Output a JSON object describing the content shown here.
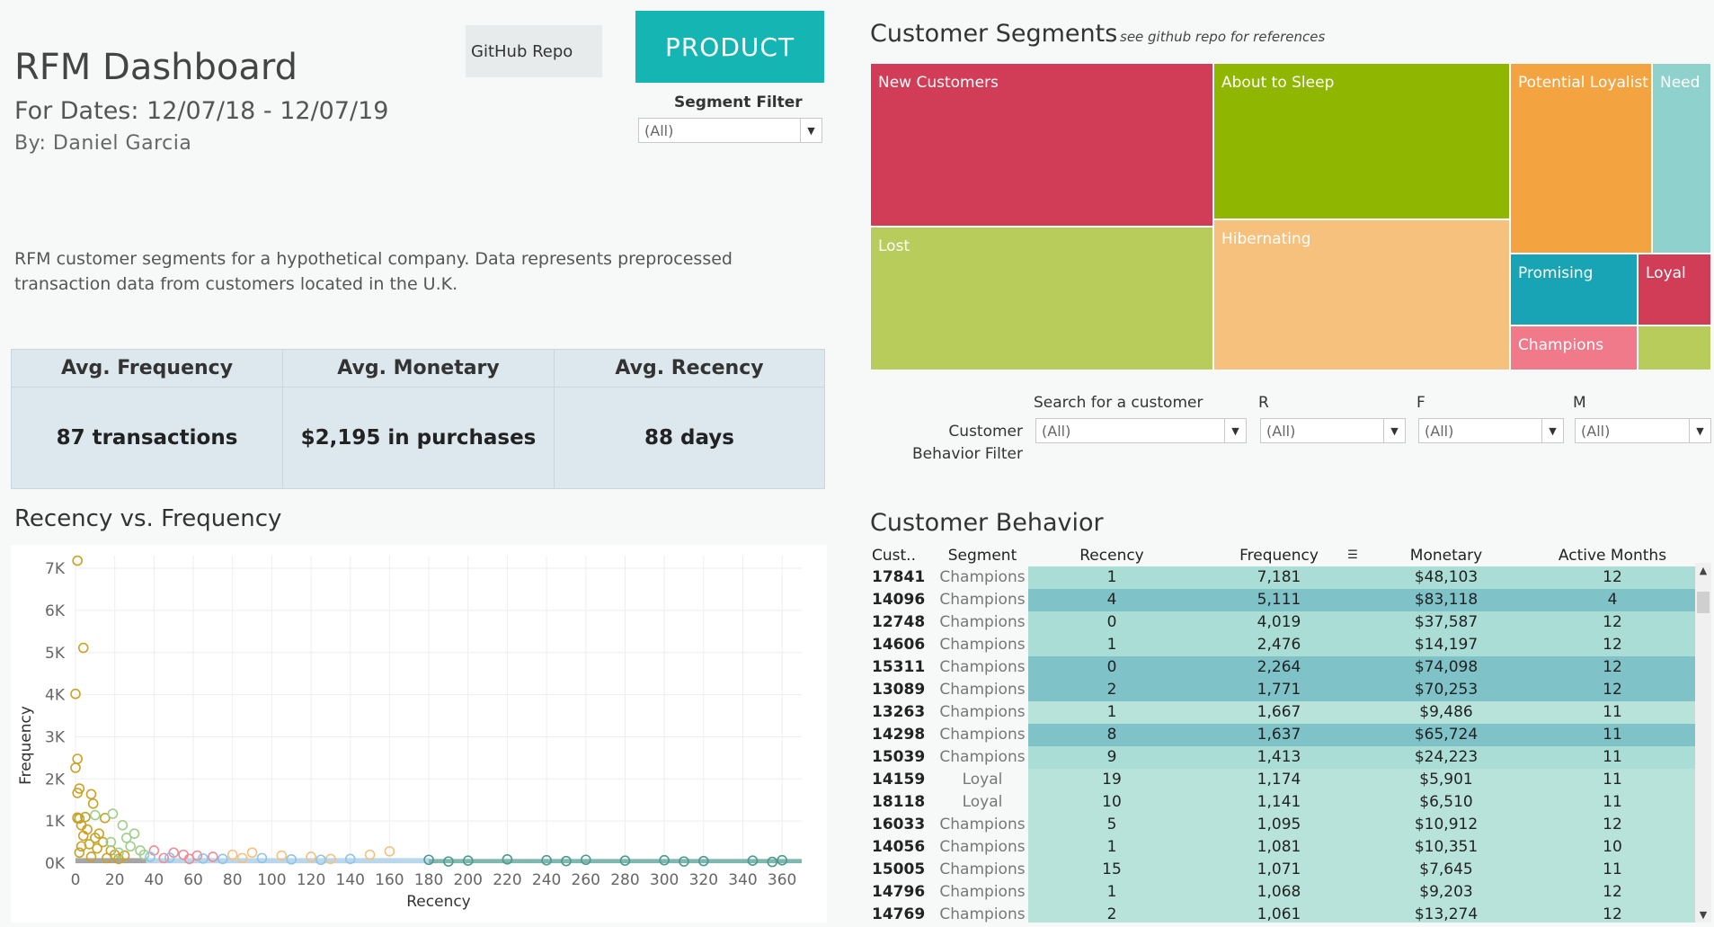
{
  "header": {
    "title": "RFM Dashboard",
    "dates": "For Dates: 12/07/18 - 12/07/19",
    "author": "By: Daniel Garcia",
    "description": "RFM customer segments for a hypothetical company. Data represents preprocessed transaction data from customers located in the  U.K.",
    "github_label": "GitHub Repo",
    "product_label": "PRODUCT",
    "segment_filter_label": "Segment Filter",
    "segment_filter_value": "(All)"
  },
  "kpis": [
    {
      "label": "Avg. Frequency",
      "value": "87 transactions"
    },
    {
      "label": "Avg. Monetary",
      "value": "$2,195 in purchases"
    },
    {
      "label": "Avg. Recency",
      "value": "88 days"
    }
  ],
  "segments_panel": {
    "title": "Customer Segments",
    "note": "see github repo for references",
    "tiles": [
      {
        "label": "New Customers",
        "color": "#d13c56"
      },
      {
        "label": "About to Sleep",
        "color": "#8fb600"
      },
      {
        "label": "Potential Loyalist",
        "color": "#f3a33f"
      },
      {
        "label": "Need",
        "color": "#8fd1cd"
      },
      {
        "label": "Lost",
        "color": "#b8cc5c"
      },
      {
        "label": "Hibernating",
        "color": "#f6c07d"
      },
      {
        "label": "Promising",
        "color": "#18a4b4"
      },
      {
        "label": "Loyal",
        "color": "#d13c56"
      },
      {
        "label": "Champions",
        "color": "#f07a8a"
      },
      {
        "label": "",
        "color": "#b8cc5c"
      }
    ]
  },
  "behavior_filters": {
    "group_label": "Customer Behavior Filter",
    "search_label": "Search for a customer",
    "search_value": "(All)",
    "r_label": "R",
    "r_value": "(All)",
    "f_label": "F",
    "f_value": "(All)",
    "m_label": "M",
    "m_value": "(All)"
  },
  "behavior_table": {
    "title": "Customer Behavior",
    "columns": [
      "Cust..",
      "Segment",
      "Recency",
      "Frequency",
      "Monetary",
      "Active Months"
    ],
    "sort_icon": "sort-descending-icon",
    "rows": [
      [
        "17841",
        "Champions",
        "1",
        "7,181",
        "$48,103",
        "12"
      ],
      [
        "14096",
        "Champions",
        "4",
        "5,111",
        "$83,118",
        "4"
      ],
      [
        "12748",
        "Champions",
        "0",
        "4,019",
        "$37,587",
        "12"
      ],
      [
        "14606",
        "Champions",
        "1",
        "2,476",
        "$14,197",
        "12"
      ],
      [
        "15311",
        "Champions",
        "0",
        "2,264",
        "$74,098",
        "12"
      ],
      [
        "13089",
        "Champions",
        "2",
        "1,771",
        "$70,253",
        "12"
      ],
      [
        "13263",
        "Champions",
        "1",
        "1,667",
        "$9,486",
        "11"
      ],
      [
        "14298",
        "Champions",
        "8",
        "1,637",
        "$65,724",
        "11"
      ],
      [
        "15039",
        "Champions",
        "9",
        "1,413",
        "$24,223",
        "11"
      ],
      [
        "14159",
        "Loyal",
        "19",
        "1,174",
        "$5,901",
        "11"
      ],
      [
        "18118",
        "Loyal",
        "10",
        "1,141",
        "$6,510",
        "11"
      ],
      [
        "16033",
        "Champions",
        "5",
        "1,095",
        "$10,912",
        "12"
      ],
      [
        "14056",
        "Champions",
        "1",
        "1,081",
        "$10,351",
        "10"
      ],
      [
        "15005",
        "Champions",
        "15",
        "1,071",
        "$7,645",
        "11"
      ],
      [
        "14796",
        "Champions",
        "1",
        "1,068",
        "$9,203",
        "12"
      ],
      [
        "14769",
        "Champions",
        "2",
        "1,061",
        "$13,274",
        "12"
      ]
    ],
    "band_colors": [
      "#a9ddd6",
      "#7fc3c9",
      "#a9ddd6",
      "#a9ddd6",
      "#7fc3c9",
      "#7fc3c9",
      "#b7e3db",
      "#7fc3c9",
      "#a9ddd6",
      "#b7e3db",
      "#b7e3db",
      "#b7e3db",
      "#b7e3db",
      "#b7e3db",
      "#b7e3db",
      "#b7e3db"
    ]
  },
  "chart_data": {
    "type": "scatter",
    "title": "Recency vs. Frequency",
    "xlabel": "Recency",
    "ylabel": "Frequency",
    "xlim": [
      0,
      370
    ],
    "ylim": [
      0,
      7300
    ],
    "x_ticks": [
      0,
      20,
      40,
      60,
      80,
      100,
      120,
      140,
      160,
      180,
      200,
      220,
      240,
      260,
      280,
      300,
      320,
      340,
      360
    ],
    "y_ticks": [
      0,
      1000,
      2000,
      3000,
      4000,
      5000,
      6000,
      7000
    ],
    "y_tick_labels": [
      "0K",
      "1K",
      "2K",
      "3K",
      "4K",
      "5K",
      "6K",
      "7K"
    ],
    "grid": true,
    "series": [
      {
        "color": "#c9a227",
        "points": [
          [
            1,
            7181
          ],
          [
            4,
            5111
          ],
          [
            0,
            4019
          ],
          [
            1,
            2476
          ],
          [
            0,
            2264
          ],
          [
            2,
            1771
          ],
          [
            1,
            1667
          ],
          [
            8,
            1637
          ],
          [
            9,
            1413
          ],
          [
            5,
            1095
          ],
          [
            1,
            1081
          ],
          [
            15,
            1071
          ],
          [
            1,
            1068
          ],
          [
            2,
            1061
          ],
          [
            3,
            900
          ],
          [
            6,
            800
          ],
          [
            12,
            700
          ],
          [
            4,
            650
          ],
          [
            10,
            600
          ],
          [
            14,
            500
          ],
          [
            7,
            450
          ],
          [
            3,
            400
          ],
          [
            11,
            350
          ],
          [
            18,
            300
          ],
          [
            2,
            250
          ],
          [
            20,
            200
          ],
          [
            25,
            180
          ],
          [
            8,
            150
          ],
          [
            16,
            120
          ],
          [
            22,
            100
          ]
        ]
      },
      {
        "color": "#9ecf8a",
        "points": [
          [
            19,
            1174
          ],
          [
            10,
            1141
          ],
          [
            24,
            900
          ],
          [
            30,
            700
          ],
          [
            26,
            600
          ],
          [
            18,
            500
          ],
          [
            28,
            400
          ],
          [
            33,
            300
          ],
          [
            22,
            250
          ],
          [
            35,
            200
          ]
        ]
      },
      {
        "color": "#f08a96",
        "points": [
          [
            40,
            300
          ],
          [
            50,
            250
          ],
          [
            55,
            200
          ],
          [
            62,
            180
          ],
          [
            70,
            150
          ],
          [
            45,
            120
          ],
          [
            58,
            100
          ]
        ]
      },
      {
        "color": "#f6c07d",
        "points": [
          [
            80,
            200
          ],
          [
            90,
            250
          ],
          [
            105,
            180
          ],
          [
            120,
            150
          ],
          [
            150,
            200
          ],
          [
            160,
            280
          ],
          [
            85,
            120
          ],
          [
            130,
            100
          ]
        ]
      },
      {
        "color": "#8fc3e8",
        "points": [
          [
            38,
            150
          ],
          [
            48,
            130
          ],
          [
            65,
            110
          ],
          [
            75,
            100
          ],
          [
            95,
            120
          ],
          [
            110,
            90
          ],
          [
            125,
            80
          ],
          [
            140,
            100
          ]
        ]
      },
      {
        "color": "#4a9a8e",
        "points": [
          [
            180,
            80
          ],
          [
            200,
            60
          ],
          [
            220,
            90
          ],
          [
            240,
            70
          ],
          [
            260,
            80
          ],
          [
            280,
            60
          ],
          [
            300,
            70
          ],
          [
            320,
            50
          ],
          [
            345,
            60
          ],
          [
            360,
            70
          ],
          [
            190,
            40
          ],
          [
            250,
            50
          ],
          [
            310,
            40
          ],
          [
            355,
            30
          ]
        ]
      }
    ]
  }
}
